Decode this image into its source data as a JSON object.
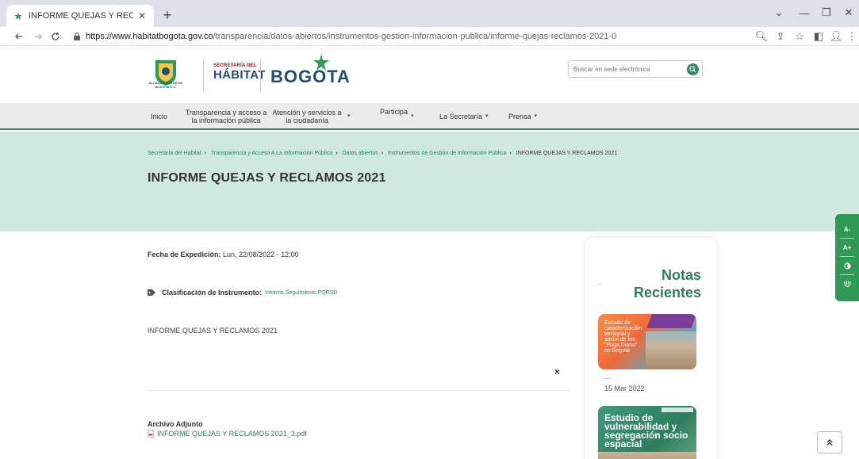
{
  "browser": {
    "tab_title": "INFORME QUEJAS Y RECLAMOS",
    "url_host": "https://www.habitatbogota.gov.co",
    "url_path": "/transparencia/datos-abiertos/instrumentos-gestion-informacion-publica/informe-quejas-reclamos-2021-0",
    "new_tab_symbol": "+",
    "back_icon": "arrow-left-icon",
    "forward_icon": "arrow-right-icon",
    "reload_icon": "reload-icon"
  },
  "header": {
    "crest_caption": "ALCALDÍA MAYOR DE BOGOTÁ D.C.",
    "sec_small": "SECRETARÍA DEL",
    "sec_big": "HÁBITAT",
    "city_logo": "BOGOTA",
    "search_placeholder": "Buscar en sede electrónica"
  },
  "nav": {
    "items": [
      {
        "label": "Inicio"
      },
      {
        "label": "Transparencia y acceso a la información pública"
      },
      {
        "label": "Atención y servicios a la ciudadanía"
      },
      {
        "label": "Participa"
      },
      {
        "label": "La Secretaría"
      },
      {
        "label": "Prensa"
      }
    ]
  },
  "breadcrumb": {
    "items": [
      "Secretaría del Habitat",
      "Transparencia y Acceso A La Información Pública",
      "Datos abiertos",
      "Instrumentos de Gestión de Información Pública"
    ],
    "current": "INFORME QUEJAS Y RECLAMOS 2021"
  },
  "page": {
    "title": "INFORME QUEJAS Y RECLAMOS 2021",
    "fecha_label": "Fecha de Expedición:",
    "fecha_value": "Lun, 22/08/2022 - 12:00",
    "clasif_label": "Clasificación de Instrumento:",
    "clasif_value": "Informe Seguimiento PQRSD",
    "body": "INFORME QUEJAS Y RECLAMOS 2021",
    "close_symbol": "×",
    "attach_label": "Archivo Adjunto",
    "attach_file": "INFORME QUEJAS Y RECLAMOS 2021_3.pdf"
  },
  "sidebar": {
    "title": "Notas Recientes",
    "dash": "—",
    "note1_text": "Estudio de caracterización territorial y social de los \"Paga Diario\" en Bogotá",
    "note1_dots": "...",
    "note1_date": "15 Mar 2022",
    "note2_text": "Estudio de vulnerabilidad y segregación socio espacial"
  },
  "a11y": {
    "decrease": "A-",
    "increase": "A+"
  },
  "colors": {
    "brand_green": "#2e7d60",
    "hero_bg": "#cfe9e1",
    "a11y_green": "#2e9a56"
  }
}
